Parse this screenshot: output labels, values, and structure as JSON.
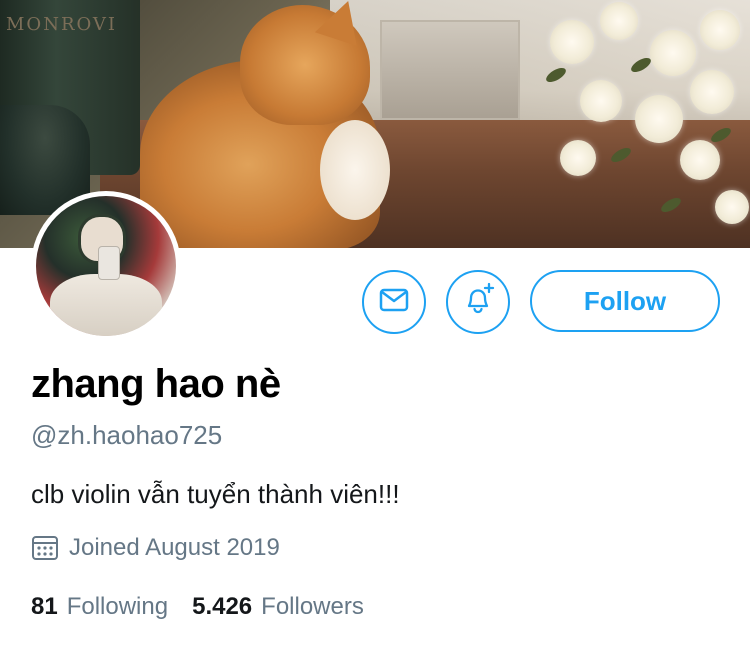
{
  "banner": {
    "bottle_label": "MONROVI",
    "description_icon": "cover-photo"
  },
  "profile": {
    "avatar_icon": "avatar",
    "display_name": "zhang hao nè",
    "handle": "@zh.haohao725",
    "bio": "clb violin vẫn tuyển thành viên!!!",
    "joined_icon": "calendar-icon",
    "joined_text": "Joined August 2019"
  },
  "actions": {
    "message_icon": "mail-icon",
    "notify_icon": "bell-plus-icon",
    "follow_label": "Follow"
  },
  "stats": {
    "following_count": "81",
    "following_label": "Following",
    "followers_count": "5.426",
    "followers_label": "Followers"
  },
  "colors": {
    "accent": "#1da1f2",
    "secondary_text": "#657786",
    "primary_text": "#14171a"
  }
}
